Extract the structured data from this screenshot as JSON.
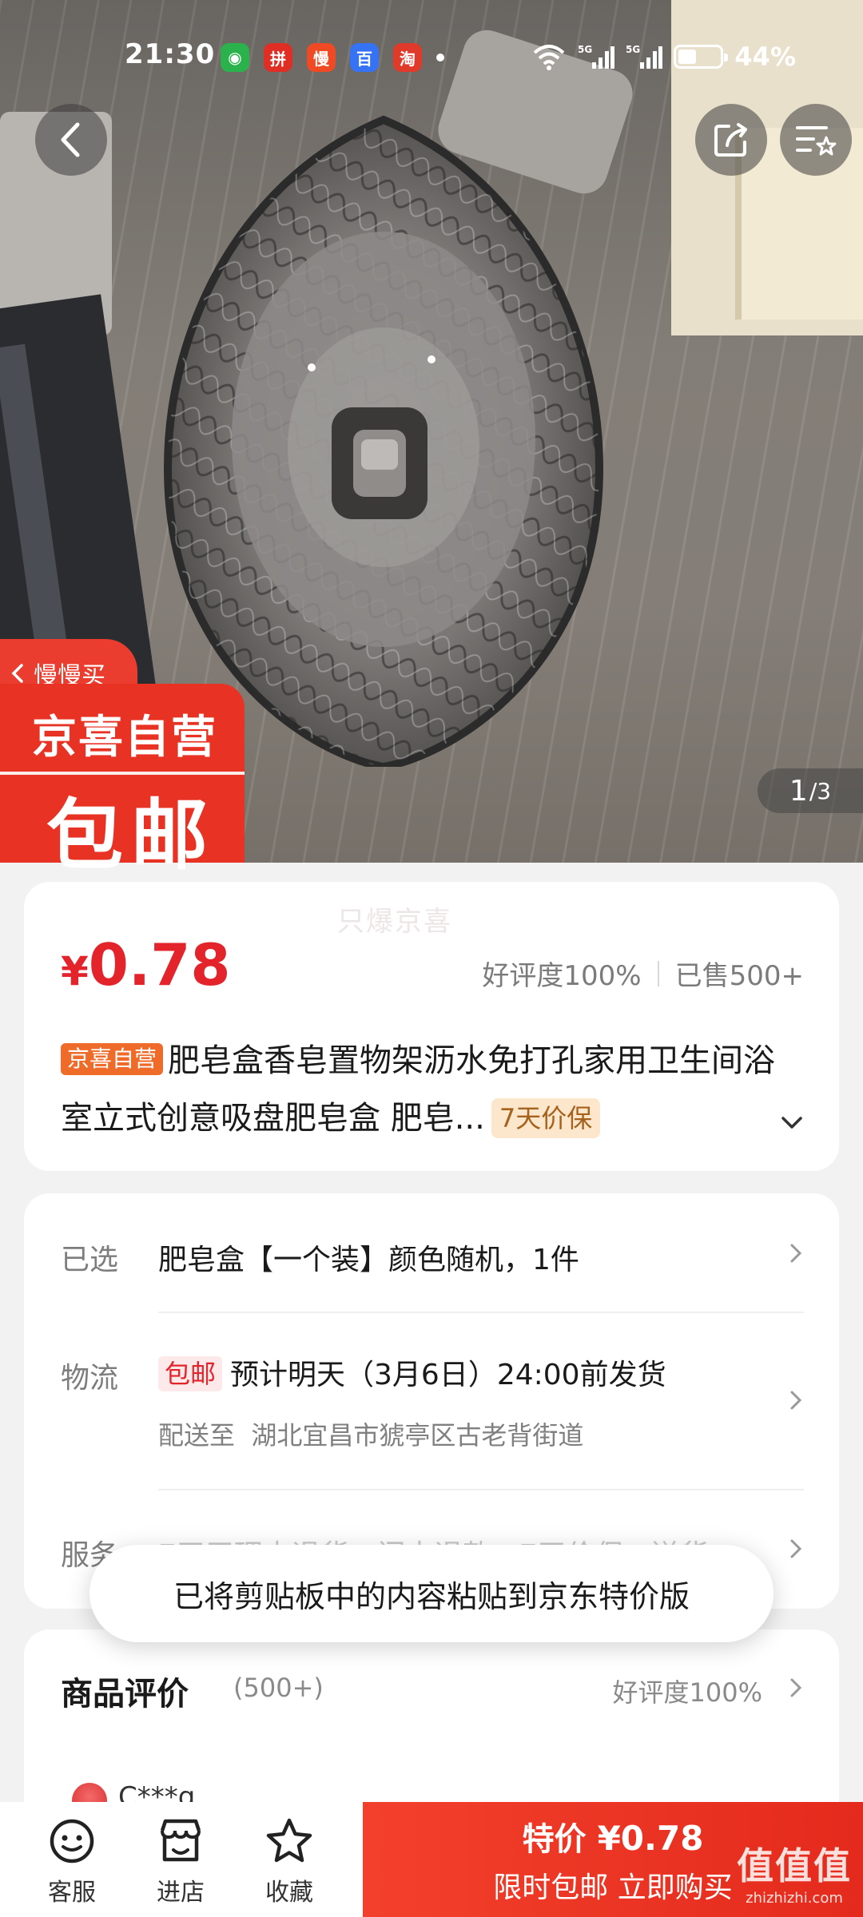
{
  "status_bar": {
    "time": "21:30",
    "apps": [
      {
        "icon": "wechat-icon",
        "color": "#2bb24c",
        "glyph": "◉"
      },
      {
        "icon": "pinduoduo-icon",
        "color": "#e02e24",
        "glyph": "拼"
      },
      {
        "icon": "manman-icon",
        "color": "#f04a24",
        "glyph": "慢"
      },
      {
        "icon": "baidu-icon",
        "color": "#3573f4",
        "glyph": "百"
      },
      {
        "icon": "taobao-icon",
        "color": "#e03a2a",
        "glyph": "淘"
      }
    ],
    "battery": "44%"
  },
  "hero": {
    "slow_buy": "慢慢买",
    "badge_line1": "京喜自营",
    "badge_line2": "包邮",
    "pager_current": "1",
    "pager_total": "/3"
  },
  "product": {
    "watermark": "只爆京喜",
    "currency": "¥",
    "price": "0.78",
    "rating": "好评度100%",
    "sold": "已售500+",
    "tag_self": "京喜自营",
    "title": "肥皂盒香皂置物架沥水免打孔家用卫生间浴室立式创意吸盘肥皂盒 肥皂...",
    "tag_guarantee": "7天价保"
  },
  "info": {
    "selected_label": "已选",
    "selected_value": "肥皂盒【一个装】颜色随机，1件",
    "logistics_label": "物流",
    "free_ship_tag": "包邮",
    "delivery": "预计明天（3月6日）24:00前发货",
    "ship_to_label": "配送至",
    "ship_to_address": "湖北宜昌市猇亭区古老背街道",
    "service_label": "服务",
    "service_value": "7天无理由退货 · 闪电退款 · 7天价保 · 送货..."
  },
  "toast": {
    "text": "已将剪贴板中的内容粘贴到京东特价版"
  },
  "reviews": {
    "title": "商品评价",
    "count": "(500+)",
    "rating": "好评度100%",
    "first_user": "C***g"
  },
  "bottom_bar": {
    "service": "客服",
    "store": "进店",
    "favorite": "收藏",
    "special_label": "特价",
    "special_price": "¥0.78",
    "buy_label": "限时包邮 立即购买"
  },
  "site_watermark": {
    "big": "值值值",
    "small": "zhizhizhi.com"
  },
  "colors": {
    "accent_red": "#e4242b",
    "buy_red": "#f3402c",
    "tag_orange": "#ef6b2a"
  }
}
